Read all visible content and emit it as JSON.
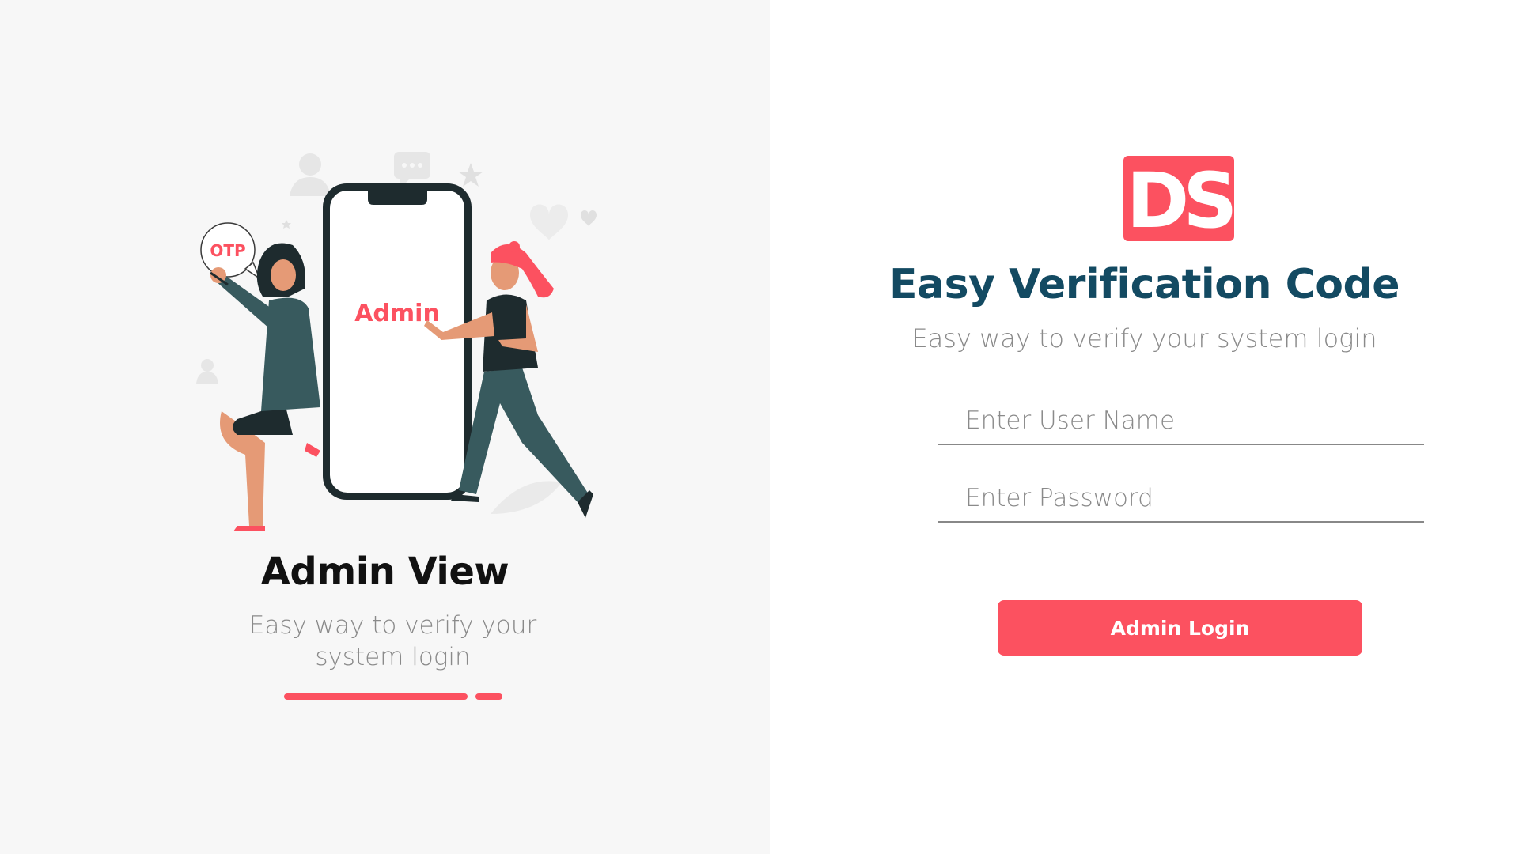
{
  "left": {
    "title": "Admin View",
    "subtitle": "Easy way to verify your system login",
    "illustration": {
      "phone_label": "Admin",
      "bubble_label": "OTP"
    },
    "carousel": {
      "slides": 2,
      "active_index": 0
    }
  },
  "right": {
    "logo_text": "DS",
    "title": "Easy Verification Code",
    "subtitle": "Easy way to verify your system login",
    "username_placeholder": "Enter User Name",
    "password_placeholder": "Enter Password",
    "login_button_label": "Admin Login"
  },
  "colors": {
    "accent": "#fc5160",
    "title_dark_teal": "#134a62",
    "left_bg": "#f7f7f7",
    "figure_dark": "#1e2b2e",
    "figure_teal": "#385a5e",
    "skin": "#e59a76"
  }
}
